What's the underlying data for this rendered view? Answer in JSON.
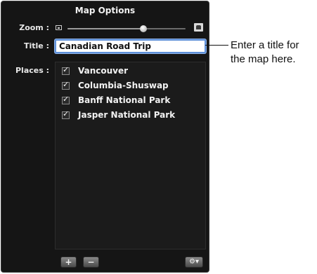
{
  "panel": {
    "title": "Map Options",
    "zoom_label": "Zoom :",
    "zoom_level": 0.64,
    "title_label": "Title :",
    "title_value": "Canadian Road Trip",
    "places_label": "Places :",
    "places": [
      {
        "label": "Vancouver",
        "checked": true
      },
      {
        "label": "Columbia-Shuswap",
        "checked": true
      },
      {
        "label": "Banff National Park",
        "checked": true
      },
      {
        "label": "Jasper National Park",
        "checked": true
      }
    ],
    "add_button": "+",
    "remove_button": "−",
    "settings_button": "⚙▾"
  },
  "callout": {
    "text": "Enter a title for the map here."
  },
  "icons": {
    "zoom_out": "small-map-icon",
    "zoom_in": "large-map-icon",
    "checkbox": "checkmark-icon",
    "settings": "gear-icon"
  }
}
